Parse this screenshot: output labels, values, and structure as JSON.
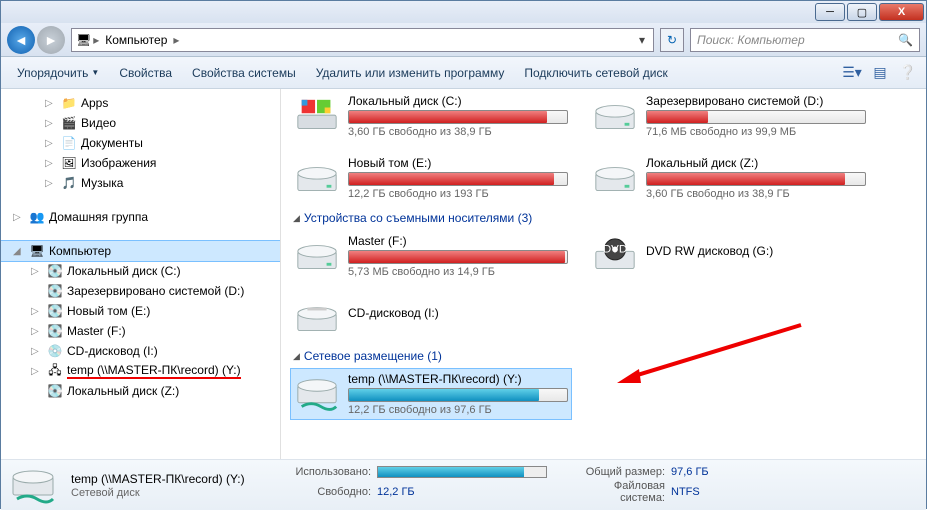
{
  "window": {
    "min": "─",
    "max": "▢",
    "close": "X"
  },
  "address": {
    "icon": "🖥",
    "crumbs": [
      "Компьютер"
    ],
    "search_placeholder": "Поиск: Компьютер"
  },
  "toolbar": {
    "organize": "Упорядочить",
    "properties": "Свойства",
    "sysprops": "Свойства системы",
    "change_program": "Удалить или изменить программу",
    "map_network": "Подключить сетевой диск"
  },
  "sidebar": {
    "items": [
      {
        "label": "Apps",
        "icon": "📁",
        "level": 2,
        "exp": "▷"
      },
      {
        "label": "Видео",
        "icon": "🎬",
        "level": 2,
        "exp": "▷"
      },
      {
        "label": "Документы",
        "icon": "📄",
        "level": 2,
        "exp": "▷"
      },
      {
        "label": "Изображения",
        "icon": "🖼",
        "level": 2,
        "exp": "▷"
      },
      {
        "label": "Музыка",
        "icon": "🎵",
        "level": 2,
        "exp": "▷"
      }
    ],
    "homegroup": {
      "label": "Домашняя группа",
      "icon": "👥",
      "exp": "▷"
    },
    "computer": {
      "label": "Компьютер",
      "icon": "🖥",
      "exp": "◢"
    },
    "drives": [
      {
        "label": "Локальный диск (C:)",
        "icon": "💽",
        "exp": "▷"
      },
      {
        "label": "Зарезервировано системой (D:)",
        "icon": "💽",
        "exp": ""
      },
      {
        "label": "Новый том (E:)",
        "icon": "💽",
        "exp": "▷"
      },
      {
        "label": "Master (F:)",
        "icon": "💽",
        "exp": "▷"
      },
      {
        "label": "CD-дисковод (I:)",
        "icon": "💿",
        "exp": "▷"
      },
      {
        "label": "temp (\\\\MASTER-ПК\\record) (Y:)",
        "icon": "🖧",
        "exp": "▷",
        "highlight": true
      },
      {
        "label": "Локальный диск (Z:)",
        "icon": "💽",
        "exp": ""
      }
    ]
  },
  "content": {
    "sec1": {
      "drives": [
        {
          "name": "Локальный диск (C:)",
          "free": "3,60 ГБ свободно из 38,9 ГБ",
          "pct": 91,
          "color": "red",
          "icon": "win"
        },
        {
          "name": "Зарезервировано системой (D:)",
          "free": "71,6 МБ свободно из 99,9 МБ",
          "pct": 28,
          "color": "red",
          "icon": "hdd"
        },
        {
          "name": "Новый том (E:)",
          "free": "12,2 ГБ свободно из 193 ГБ",
          "pct": 94,
          "color": "red",
          "icon": "hdd"
        },
        {
          "name": "Локальный диск (Z:)",
          "free": "3,60 ГБ свободно из 38,9 ГБ",
          "pct": 91,
          "color": "red",
          "icon": "hdd"
        }
      ]
    },
    "sec2": {
      "title": "Устройства со съемными носителями (3)",
      "drives": [
        {
          "name": "Master (F:)",
          "free": "5,73 МБ свободно из 14,9 ГБ",
          "pct": 99,
          "color": "red",
          "icon": "hdd"
        },
        {
          "name": "DVD RW дисковод (G:)",
          "nobar": true,
          "icon": "dvd"
        },
        {
          "name": "CD-дисковод (I:)",
          "nobar": true,
          "icon": "cd"
        }
      ]
    },
    "sec3": {
      "title": "Сетевое размещение (1)",
      "drives": [
        {
          "name": "temp (\\\\MASTER-ПК\\record) (Y:)",
          "free": "12,2 ГБ свободно из 97,6 ГБ",
          "pct": 87,
          "color": "blue",
          "icon": "net",
          "selected": true
        }
      ]
    }
  },
  "details": {
    "title": "temp (\\\\MASTER-ПК\\record) (Y:)",
    "type": "Сетевой диск",
    "used_lbl": "Использовано:",
    "used_pct": 87,
    "free_lbl": "Свободно:",
    "free_val": "12,2 ГБ",
    "total_lbl": "Общий размер:",
    "total_val": "97,6 ГБ",
    "fs_lbl": "Файловая система:",
    "fs_val": "NTFS"
  }
}
